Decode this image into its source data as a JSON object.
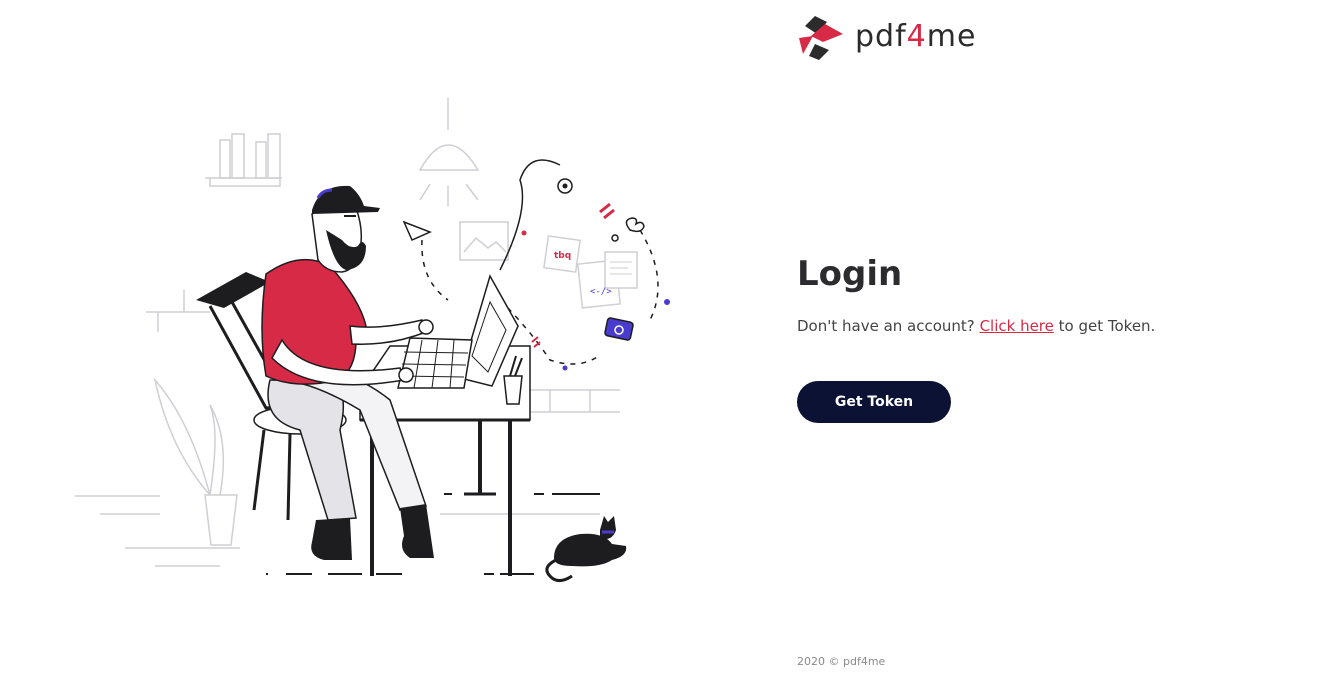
{
  "brand": {
    "name_prefix": "pdf",
    "name_accent": "4",
    "name_suffix": "me",
    "accent_color": "#d62a46",
    "dark_color": "#2b2b2b"
  },
  "login": {
    "title": "Login",
    "prompt_before": "Don't have an account?",
    "link_text": "Click here",
    "prompt_after": "to get Token.",
    "button_label": "Get Token",
    "button_color": "#0b1233"
  },
  "illustration": {
    "note_label": "tbq",
    "code_label": "<-/>"
  },
  "footer": {
    "text": "2020 © pdf4me"
  }
}
